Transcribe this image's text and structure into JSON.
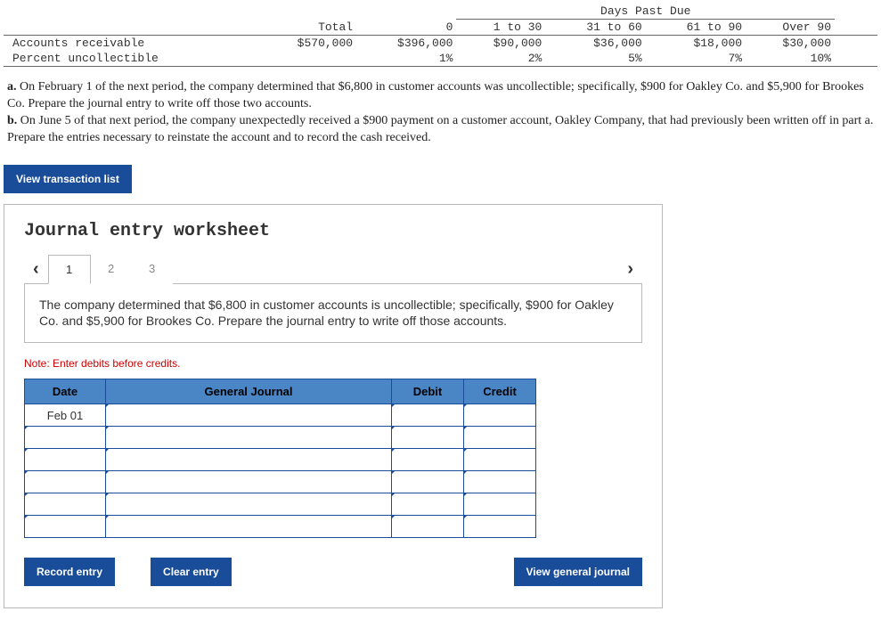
{
  "aging": {
    "super_header": "Days Past Due",
    "cols": [
      "Total",
      "0",
      "1 to 30",
      "31 to 60",
      "61 to 90",
      "Over 90"
    ],
    "rows": [
      {
        "label": "Accounts receivable",
        "vals": [
          "$570,000",
          "$396,000",
          "$90,000",
          "$36,000",
          "$18,000",
          "$30,000"
        ]
      },
      {
        "label": "Percent uncollectible",
        "vals": [
          "",
          "1%",
          "2%",
          "5%",
          "7%",
          "10%"
        ]
      }
    ]
  },
  "question": {
    "a_label": "a.",
    "a_text": " On February 1 of the next period, the company determined that $6,800 in customer accounts was uncollectible; specifically, $900 for Oakley Co. and $5,900 for Brookes Co. Prepare the journal entry to write off those two accounts.",
    "b_label": "b.",
    "b_text": " On June 5 of that next period, the company unexpectedly received a $900 payment on a customer account, Oakley Company, that had previously been written off in part a. Prepare the entries necessary to reinstate the account and to record the cash received."
  },
  "buttons": {
    "view_trans": "View transaction list",
    "record": "Record entry",
    "clear": "Clear entry",
    "view_gj": "View general journal"
  },
  "worksheet": {
    "title": "Journal entry worksheet",
    "tabs": [
      "1",
      "2",
      "3"
    ],
    "instruction": "The company determined that $6,800 in customer accounts is uncollectible; specifically, $900 for Oakley Co. and $5,900 for Brookes Co. Prepare the journal entry to write off those accounts.",
    "note": "Note: Enter debits before credits.",
    "headers": {
      "date": "Date",
      "gj": "General Journal",
      "debit": "Debit",
      "credit": "Credit"
    },
    "date_value": "Feb 01"
  }
}
